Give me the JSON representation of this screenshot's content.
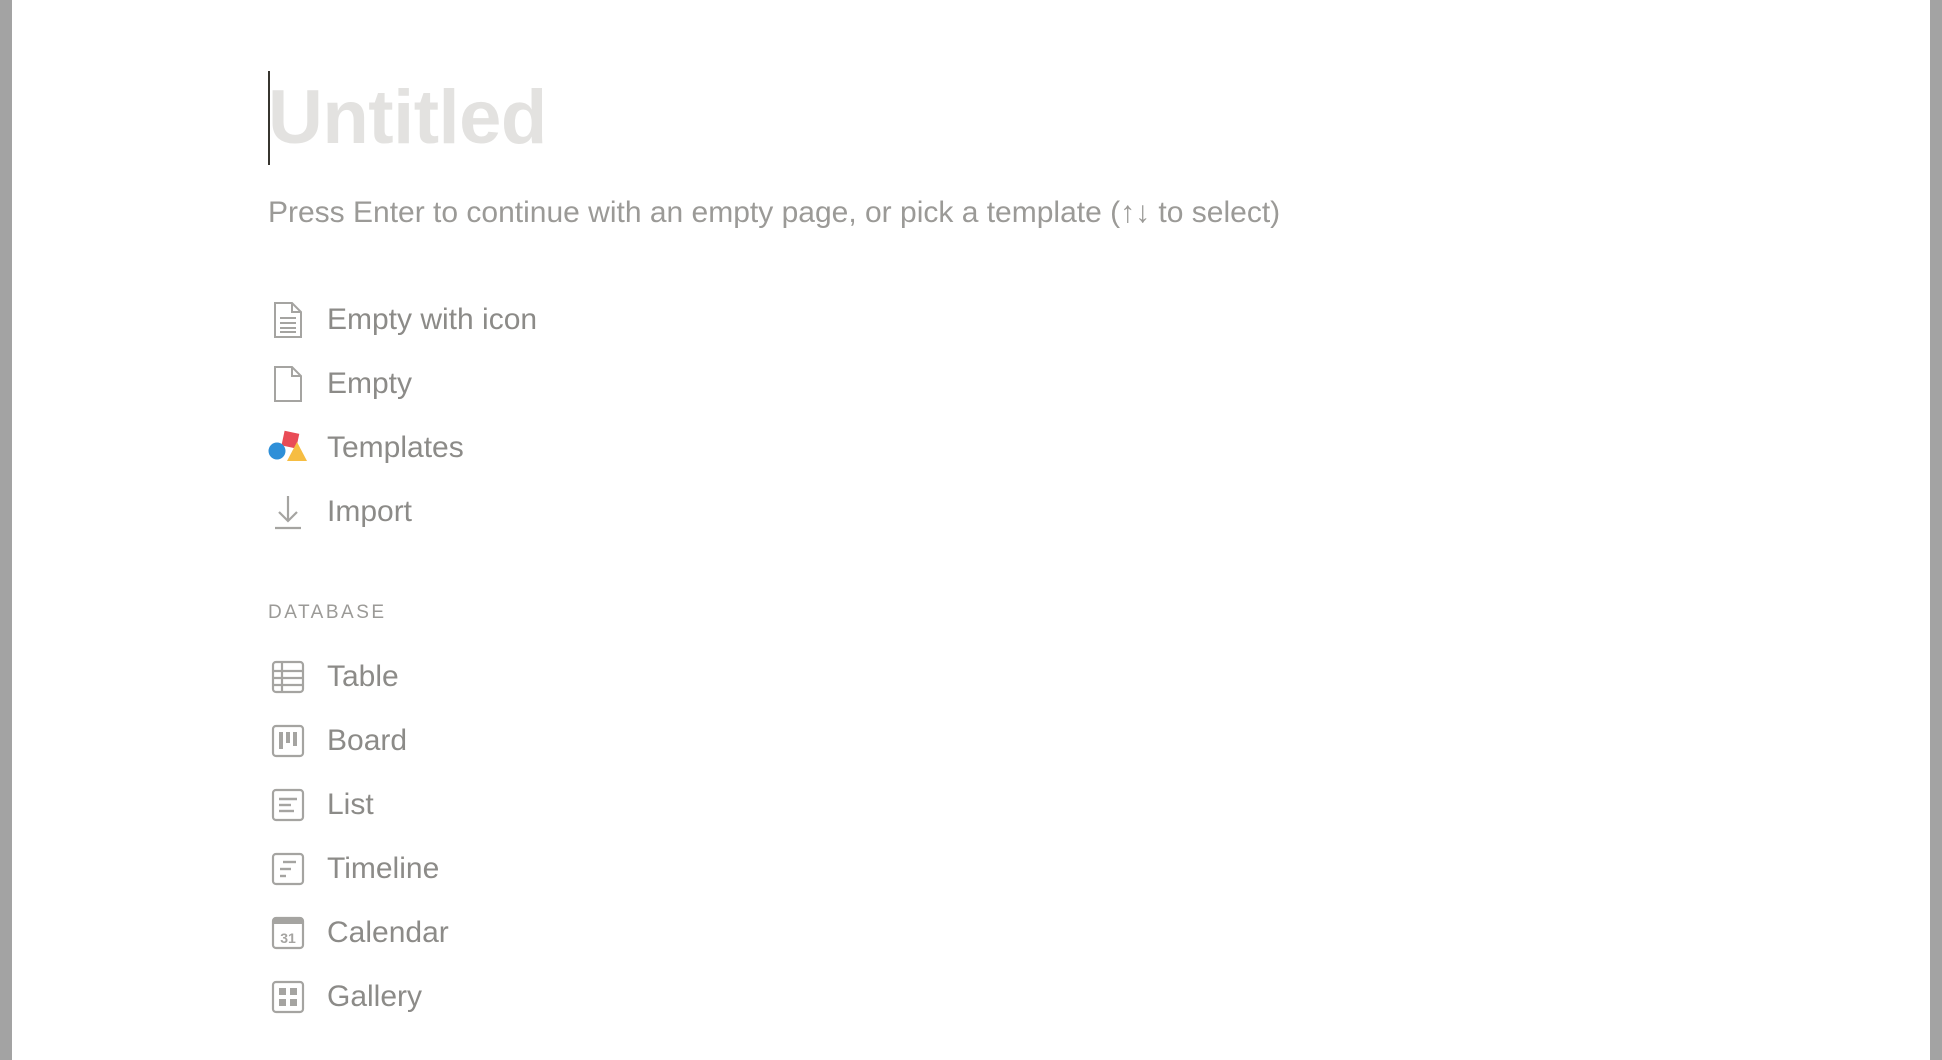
{
  "page": {
    "title_placeholder": "Untitled",
    "hint": "Press Enter to continue with an empty page, or pick a template (↑↓ to select)"
  },
  "options": [
    {
      "label": "Empty with icon",
      "icon": "page-with-lines-icon"
    },
    {
      "label": "Empty",
      "icon": "blank-page-icon"
    },
    {
      "label": "Templates",
      "icon": "templates-shapes-icon"
    },
    {
      "label": "Import",
      "icon": "import-arrow-icon"
    }
  ],
  "database": {
    "section_title": "DATABASE",
    "items": [
      {
        "label": "Table",
        "icon": "table-icon"
      },
      {
        "label": "Board",
        "icon": "board-icon"
      },
      {
        "label": "List",
        "icon": "list-icon"
      },
      {
        "label": "Timeline",
        "icon": "timeline-icon"
      },
      {
        "label": "Calendar",
        "icon": "calendar-icon",
        "icon_text": "31"
      },
      {
        "label": "Gallery",
        "icon": "gallery-icon"
      }
    ]
  },
  "colors": {
    "title_placeholder": "#e3e2e0",
    "text_muted": "#9b9a97",
    "icon_gray": "#a5a4a1",
    "templates_red": "#e94b56",
    "templates_blue": "#2e8fd8",
    "templates_yellow": "#f6bd42"
  }
}
